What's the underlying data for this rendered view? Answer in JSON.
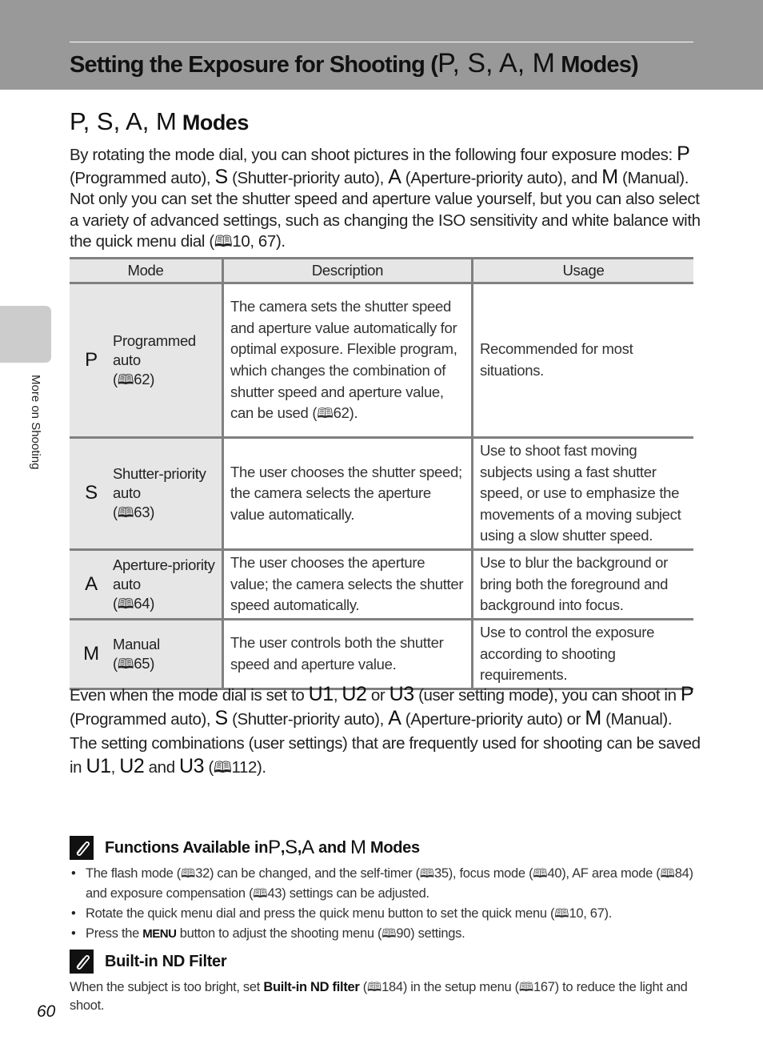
{
  "banner": {
    "title_prefix": "Setting the Exposure for Shooting (",
    "title_modes": "P, S, A, M",
    "title_suffix": " Modes)"
  },
  "side_tab": {
    "label": "More on Shooting"
  },
  "section": {
    "title_modes": "P, S, A, M",
    "title_suffix": " Modes"
  },
  "intro": {
    "t1": "By rotating the mode dial, you can shoot pictures in the following four exposure modes: ",
    "p": "P",
    "t2": " (Programmed auto), ",
    "s": "S",
    "t3": " (Shutter-priority auto), ",
    "a": "A",
    "t4": " (Aperture-priority auto), and ",
    "m": "M",
    "t5": " (Manual). Not only you can set the shutter speed and aperture value yourself, but you can also select a variety of advanced settings, such as changing the ISO sensitivity and white balance with the quick menu dial (",
    "ref": "10, 67",
    "t6": ")."
  },
  "book_icon": "🕮",
  "table": {
    "headers": [
      "Mode",
      "Description",
      "Usage"
    ],
    "rows": [
      {
        "letter": "P",
        "name": "Programmed auto",
        "ref": "62",
        "description": "The camera sets the shutter speed and aperture value automatically for optimal exposure. Flexible program, which changes the combination of shutter speed and aperture value, can be used (",
        "description_ref": "62",
        "description_end": ").",
        "usage": "Recommended for most situations."
      },
      {
        "letter": "S",
        "name": "Shutter-priority auto",
        "ref": "63",
        "description": "The user chooses the shutter speed; the camera selects the aperture value automatically.",
        "usage": "Use to shoot fast moving subjects using a fast shutter speed, or use to emphasize the movements of a moving subject using a slow shutter speed."
      },
      {
        "letter": "A",
        "name": "Aperture-priority auto",
        "ref": "64",
        "description": "The user chooses the aperture value; the camera selects the shutter speed automatically.",
        "usage": "Use to blur the background or bring both the foreground and background into focus."
      },
      {
        "letter": "M",
        "name": "Manual",
        "ref": "65",
        "description": "The user controls both the shutter speed and aperture value.",
        "usage": "Use to control the exposure according to shooting requirements."
      }
    ]
  },
  "user_modes": {
    "t1": "Even when the mode dial is set to ",
    "u1": "U1",
    "c1": ", ",
    "u2": "U2",
    "t2": " or ",
    "u3": "U3",
    "t3": " (user setting mode), you can shoot in ",
    "p": "P",
    "t4": " (Programmed auto), ",
    "s": "S",
    "t5": " (Shutter-priority auto), ",
    "a": "A",
    "t6": " (Aperture-priority auto) or ",
    "m": "M",
    "t7": " (Manual). The setting combinations (user settings) that are frequently used for shooting can be saved in ",
    "u1b": "U1",
    "c2": ", ",
    "u2b": "U2",
    "t8": " and ",
    "u3b": "U3",
    "t9": " (",
    "ref": "112",
    "t10": ")."
  },
  "note_functions": {
    "icon": "pencil-icon",
    "title_prefix": "Functions Available in ",
    "p": "P",
    "c1": ", ",
    "s": "S",
    "c2": ", ",
    "a": "A",
    "and": " and ",
    "m": "M",
    "title_suffix": " Modes",
    "bullets": [
      {
        "t1": "The flash mode (",
        "r1": "32",
        "t2": ") can be changed, and the self-timer (",
        "r2": "35",
        "t3": "), focus mode (",
        "r3": "40",
        "t4": "), AF area mode (",
        "r4": "84",
        "t5": ") and exposure compensation (",
        "r5": "43",
        "t6": ") settings can be adjusted."
      },
      {
        "t1": "Rotate the quick menu dial and press the quick menu button to set the quick menu (",
        "r1": "10, 67",
        "t2": ")."
      },
      {
        "t1": "Press the ",
        "menu": "MENU",
        "t2": " button to adjust the shooting menu (",
        "r1": "90",
        "t3": ") settings."
      }
    ]
  },
  "note_nd": {
    "icon": "pencil-icon",
    "title": "Built-in ND Filter",
    "t1": "When the subject is too bright, set ",
    "bold": "Built-in ND filter",
    "t2": " (",
    "r1": "184",
    "t3": ") in the setup menu (",
    "r2": "167",
    "t4": ") to reduce the light and shoot."
  },
  "page_number": "60",
  "colors": {
    "banner": "#999999",
    "side_tab": "#cccccc",
    "table_rule": "#808080",
    "table_shade": "#e6e6e6"
  }
}
